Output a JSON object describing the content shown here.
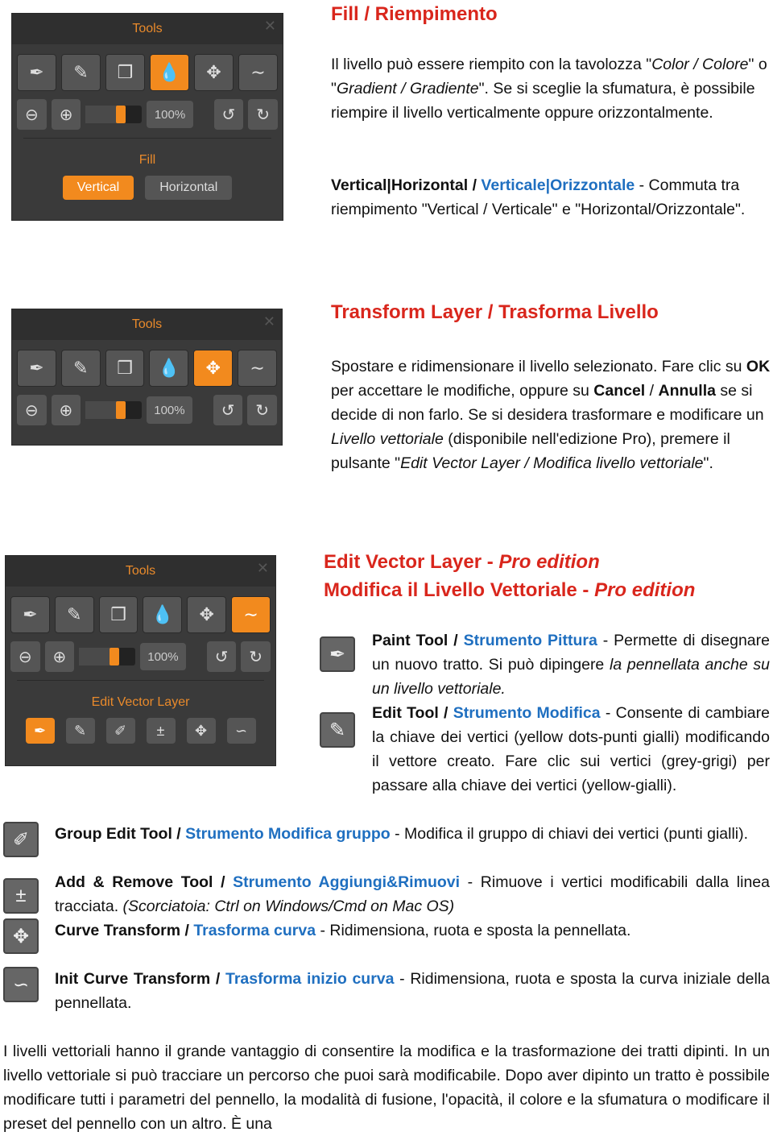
{
  "sections": [
    {
      "heading": "Fill / Riempimento",
      "panel": {
        "title": "Tools",
        "active": 3,
        "zoom": "100%",
        "section_title": "Fill",
        "section_buttons": [
          {
            "label": "Vertical",
            "on": true
          },
          {
            "label": "Horizontal",
            "on": false
          }
        ]
      },
      "paragraphs": [
        [
          {
            "t": "Il livello può essere riempito con la tavolozza \""
          },
          {
            "t": "Color / Colore",
            "s": "i"
          },
          {
            "t": "\" o \""
          },
          {
            "t": "Gradient / Gradiente",
            "s": "i"
          },
          {
            "t": "\". Se si sceglie la sfumatura, è possibile riempire il livello verticalmente oppure orizzontalmente."
          }
        ],
        [
          {
            "t": "Vertical|Horizontal / ",
            "s": "b"
          },
          {
            "t": "Verticale|Orizzontale",
            "s": "blue"
          },
          {
            "t": " - Commuta tra riempimento \"Vertical / Verticale\" e \"Horizontal/Orizzontale\"."
          }
        ]
      ]
    },
    {
      "heading": "Transform Layer / Trasforma Livello",
      "panel": {
        "title": "Tools",
        "active": 4,
        "zoom": "100%"
      },
      "paragraphs": [
        [
          {
            "t": "Spostare e ridimensionare il livello selezionato. Fare clic su "
          },
          {
            "t": "OK",
            "s": "b"
          },
          {
            "t": " per accettare le modifiche, oppure su "
          },
          {
            "t": "Cancel",
            "s": "b"
          },
          {
            "t": " / "
          },
          {
            "t": "Annulla",
            "s": "b"
          },
          {
            "t": " se si decide di non farlo. Se si desidera trasformare e modificare un "
          },
          {
            "t": "Livello vettoriale",
            "s": "i"
          },
          {
            "t": " (disponibile nell'edizione Pro), premere il pulsante \""
          },
          {
            "t": "Edit Vector Layer / Modifica livello vettoriale",
            "s": "i"
          },
          {
            "t": "\"."
          }
        ]
      ]
    },
    {
      "heading_line1": [
        {
          "t": "Edit Vector Layer - "
        },
        {
          "t": "Pro edition",
          "s": "i"
        }
      ],
      "heading_line2": [
        {
          "t": "Modifica il Livello Vettoriale - "
        },
        {
          "t": "Pro edition",
          "s": "i"
        }
      ],
      "panel": {
        "title": "Tools",
        "active": 5,
        "zoom": "100%",
        "section_title": "Edit Vector Layer",
        "section_icons": [
          "paint-icon",
          "edit-pen-icon",
          "group-edit-icon",
          "add-remove-icon",
          "curve-transform-icon",
          "init-curve-icon"
        ]
      },
      "items": [
        {
          "icon": "paint-icon",
          "glyph": "✒",
          "text": [
            {
              "t": "Paint Tool / ",
              "s": "b"
            },
            {
              "t": "Strumento Pittura",
              "s": "blue"
            },
            {
              "t": " - Permette di disegnare un nuovo tratto. Si può dipingere "
            },
            {
              "t": "la pennellata anche su un livello vettoriale.",
              "s": "i"
            }
          ]
        },
        {
          "icon": "edit-pen-icon",
          "glyph": "✎",
          "text": [
            {
              "t": "Edit Tool / ",
              "s": "b"
            },
            {
              "t": "Strumento Modifica",
              "s": "blue"
            },
            {
              "t": " - Consente di cambiare la chiave dei vertici (yellow dots-punti gialli) modificando il vettore creato. Fare clic sui vertici (grey-grigi) per passare alla chiave dei vertici (yellow-gialli)."
            }
          ]
        },
        {
          "icon": "group-edit-icon",
          "glyph": "✐",
          "text": [
            {
              "t": "Group Edit Tool / ",
              "s": "b"
            },
            {
              "t": "Strumento Modifica gruppo",
              "s": "blue"
            },
            {
              "t": " - Modifica il gruppo di chiavi dei vertici (punti gialli)."
            }
          ]
        },
        {
          "icon": "add-remove-icon",
          "glyph": "±",
          "text": [
            {
              "t": "Add & Remove Tool / ",
              "s": "b"
            },
            {
              "t": "Strumento Aggiungi&Rimuovi",
              "s": "blue"
            },
            {
              "t": " - Rimuove i vertici modificabili dalla linea tracciata. "
            },
            {
              "t": "(Scorciatoia: Ctrl on Windows/Cmd on Mac OS)",
              "s": "i"
            }
          ]
        },
        {
          "icon": "curve-transform-icon",
          "glyph": "✥",
          "text": [
            {
              "t": "Curve Transform / ",
              "s": "b"
            },
            {
              "t": "Trasforma curva",
              "s": "blue"
            },
            {
              "t": " - Ridimensiona, ruota e sposta la pennellata."
            }
          ]
        },
        {
          "icon": "init-curve-icon",
          "glyph": "∽",
          "text": [
            {
              "t": "Init Curve Transform / ",
              "s": "b"
            },
            {
              "t": "Trasforma inizio curva",
              "s": "blue"
            },
            {
              "t": " - Ridimensiona, ruota e sposta la curva iniziale della pennellata."
            }
          ]
        }
      ]
    }
  ],
  "footer": [
    {
      "t": "I livelli vettoriali hanno il grande vantaggio di consentire la modifica e la trasformazione dei tratti dipinti. In un livello vettoriale si può tracciare un percorso che puoi sarà modificabile. Dopo aver dipinto un tratto è possibile modificare tutti i parametri del pennello, la modalità di fusione, l'opacità, il colore e la sfumatura o modificare il preset del pennello con un altro. È una"
    }
  ],
  "tool_icons": [
    {
      "name": "brush-icon",
      "glyph": "✒"
    },
    {
      "name": "pencil-icon",
      "glyph": "✎"
    },
    {
      "name": "layers-icon",
      "glyph": "❒"
    },
    {
      "name": "fill-drop-icon",
      "glyph": "💧"
    },
    {
      "name": "transform-icon",
      "glyph": "✥"
    },
    {
      "name": "curve-icon",
      "glyph": "∼"
    }
  ],
  "colors": {
    "accent": "#f28a1e",
    "heading": "#d9261c",
    "link": "#1f6fc0",
    "panel": "#3a3a3a"
  }
}
